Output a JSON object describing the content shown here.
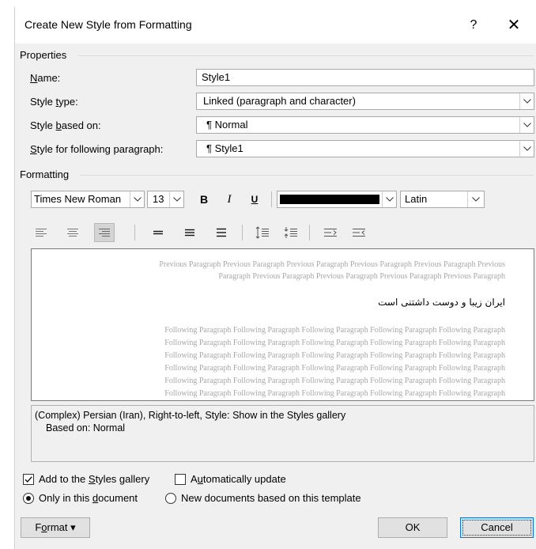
{
  "window": {
    "title": "Create New Style from Formatting",
    "help_label": "?",
    "close_label": "✕"
  },
  "properties": {
    "section_label": "Properties",
    "name": {
      "label_pre": "",
      "label_ul": "N",
      "label_post": "ame:",
      "value": "Style1"
    },
    "style_type": {
      "label_pre": "Style ",
      "label_ul": "t",
      "label_post": "ype:",
      "value": "Linked (paragraph and character)"
    },
    "based_on": {
      "label_pre": "Style ",
      "label_ul": "b",
      "label_post": "ased on:",
      "value": "Normal",
      "icon": "pilcrow-icon"
    },
    "following": {
      "label_pre": "",
      "label_ul": "S",
      "label_post": "tyle for following paragraph:",
      "value": "Style1",
      "icon": "pilcrow-icon"
    }
  },
  "formatting": {
    "section_label": "Formatting",
    "font": "Times New Roman",
    "size": "13",
    "bold": "B",
    "italic": "I",
    "underline": "U",
    "font_color": "#000000",
    "script": "Latin"
  },
  "preview": {
    "previous_lines": [
      "Previous Paragraph Previous Paragraph Previous Paragraph Previous Paragraph Previous Paragraph Previous",
      "Paragraph Previous Paragraph Previous Paragraph Previous Paragraph Previous Paragraph"
    ],
    "sample_text": "ایران زیبا و دوست داشتنی است",
    "following_lines": [
      "Following Paragraph Following Paragraph Following Paragraph Following Paragraph Following Paragraph",
      "Following Paragraph Following Paragraph Following Paragraph Following Paragraph Following Paragraph",
      "Following Paragraph Following Paragraph Following Paragraph Following Paragraph Following Paragraph",
      "Following Paragraph Following Paragraph Following Paragraph Following Paragraph Following Paragraph",
      "Following Paragraph Following Paragraph Following Paragraph Following Paragraph Following Paragraph",
      "Following Paragraph Following Paragraph Following Paragraph Following Paragraph Following Paragraph"
    ]
  },
  "description": {
    "line1": "(Complex) Persian (Iran), Right-to-left, Style: Show in the Styles gallery",
    "line2": "Based on: Normal"
  },
  "options": {
    "add_to_gallery": {
      "pre": "Add to the ",
      "ul": "S",
      "post": "tyles gallery",
      "checked": true
    },
    "auto_update": {
      "pre": "A",
      "ul": "u",
      "post": "tomatically update",
      "checked": false
    },
    "only_this_doc": {
      "pre": "Only in this ",
      "ul": "d",
      "post": "ocument",
      "selected": true
    },
    "new_docs": {
      "label": "New documents based on this template",
      "selected": false
    }
  },
  "buttons": {
    "format": {
      "pre": "F",
      "ul": "o",
      "post": "rmat ▾"
    },
    "ok": "OK",
    "cancel": "Cancel"
  }
}
